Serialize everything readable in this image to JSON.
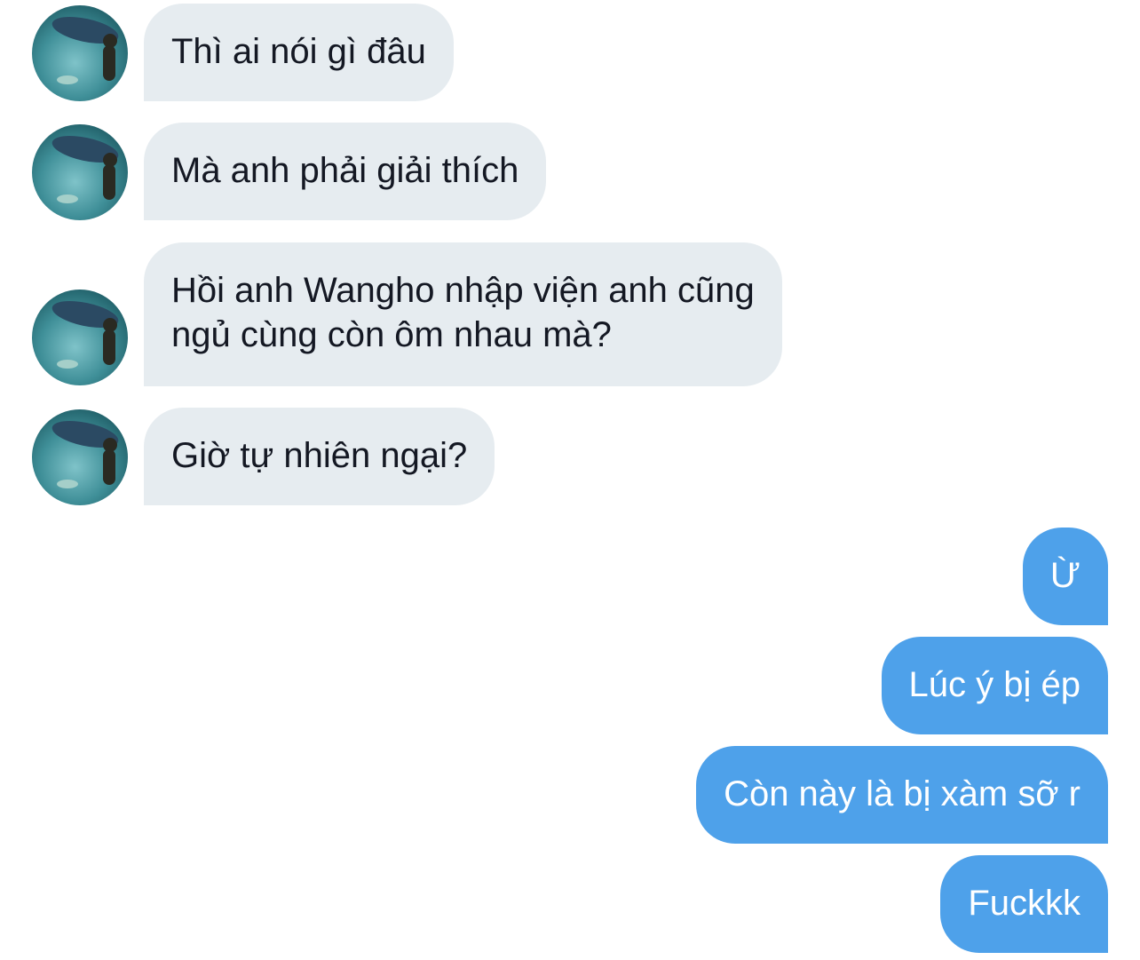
{
  "conversation": {
    "incoming": [
      {
        "lines": [
          "Thì ai nói gì đâu"
        ]
      },
      {
        "lines": [
          "Mà anh phải giải thích"
        ]
      },
      {
        "lines": [
          "Hồi anh Wangho nhập viện anh cũng",
          "ngủ cùng còn ôm nhau mà?"
        ]
      },
      {
        "lines": [
          "Giờ tự nhiên ngại?"
        ]
      }
    ],
    "outgoing": [
      {
        "text": "Ừ"
      },
      {
        "text": "Lúc ý bị ép"
      },
      {
        "text": "Còn này là bị xàm sỡ r"
      },
      {
        "text": "Fuckkk"
      }
    ]
  },
  "avatar": {
    "icon": "avatar-photo-aquarium"
  },
  "colors": {
    "incoming_bubble": "#e6ecf0",
    "outgoing_bubble": "#4ea1ea",
    "incoming_text": "#141823",
    "outgoing_text": "#ffffff"
  }
}
